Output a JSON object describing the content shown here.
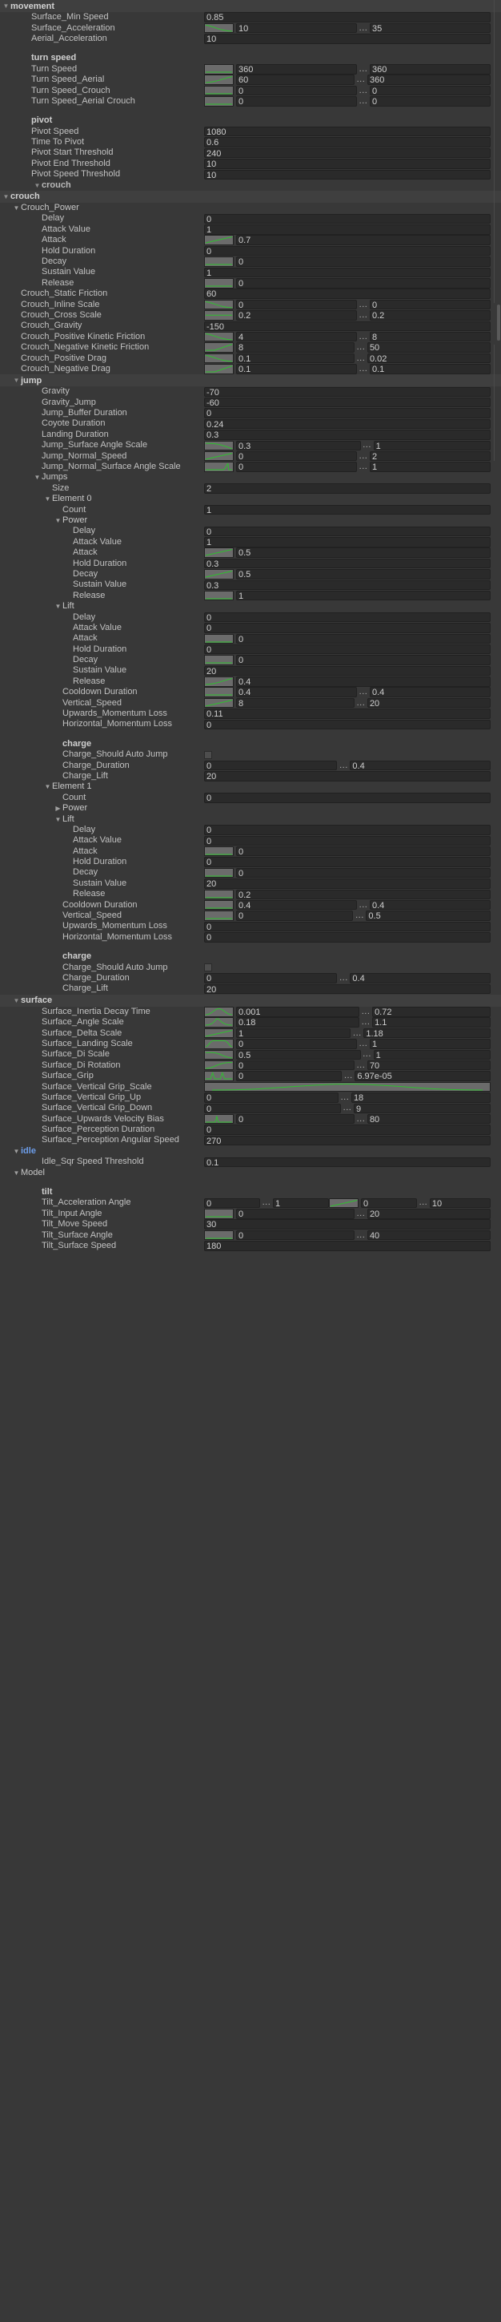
{
  "panel": {
    "title": "movement",
    "accent_color": "#6d9eeb",
    "curve_color": "#2fbf2f"
  },
  "icons": {
    "foldout_open": "▼",
    "foldout_closed": "▶",
    "range_dots": "...",
    "curve": "curve-swatch",
    "checkbox": "checkbox"
  },
  "sections": [
    {
      "kind": "header",
      "label": "movement",
      "indent": 0,
      "open": true,
      "accent": false,
      "name": "section-movement"
    },
    {
      "kind": "field",
      "label": "Surface_Min Speed",
      "indent": 2,
      "value": "0.85"
    },
    {
      "kind": "field",
      "label": "Surface_Acceleration",
      "indent": 2,
      "curve": "down",
      "value": "10",
      "dots": "...",
      "value2": "35"
    },
    {
      "kind": "field",
      "label": "Aerial_Acceleration",
      "indent": 2,
      "value": "10"
    },
    {
      "kind": "spacer"
    },
    {
      "kind": "group",
      "label": "turn speed",
      "indent": 2
    },
    {
      "kind": "field",
      "label": "Turn Speed",
      "indent": 2,
      "curve": "flat",
      "value": "360",
      "dots": "...",
      "value2": "360"
    },
    {
      "kind": "field",
      "label": "Turn Speed_Aerial",
      "indent": 2,
      "curve": "easein",
      "value": "60",
      "dots": "...",
      "value2": "360"
    },
    {
      "kind": "field",
      "label": "Turn Speed_Crouch",
      "indent": 2,
      "curve": "flat",
      "value": "0",
      "dots": "...",
      "value2": "0"
    },
    {
      "kind": "field",
      "label": "Turn Speed_Aerial Crouch",
      "indent": 2,
      "curve": "flat",
      "value": "0",
      "dots": "...",
      "value2": "0"
    },
    {
      "kind": "spacer"
    },
    {
      "kind": "group",
      "label": "pivot",
      "indent": 2
    },
    {
      "kind": "field",
      "label": "Pivot Speed",
      "indent": 2,
      "value": "1080"
    },
    {
      "kind": "field",
      "label": "Time To Pivot",
      "indent": 2,
      "value": "0.6"
    },
    {
      "kind": "field",
      "label": "Pivot Start Threshold",
      "indent": 2,
      "value": "240"
    },
    {
      "kind": "field",
      "label": "Pivot End Threshold",
      "indent": 2,
      "value": "10"
    },
    {
      "kind": "field",
      "label": "Pivot Speed Threshold",
      "indent": 2,
      "value": "10"
    },
    {
      "kind": "foldout",
      "label": "crouch",
      "indent": 3,
      "open": true,
      "bold": true,
      "dim": true
    },
    {
      "kind": "header",
      "label": "crouch",
      "indent": 0,
      "open": true,
      "accent": false,
      "name": "section-crouch"
    },
    {
      "kind": "foldout",
      "label": "Crouch_Power",
      "indent": 1,
      "open": true
    },
    {
      "kind": "field",
      "label": "Delay",
      "indent": 3,
      "value": "0"
    },
    {
      "kind": "field",
      "label": "Attack Value",
      "indent": 3,
      "value": "1"
    },
    {
      "kind": "field",
      "label": "Attack",
      "indent": 3,
      "curve": "linear",
      "value": "0.7"
    },
    {
      "kind": "field",
      "label": "Hold Duration",
      "indent": 3,
      "value": "0"
    },
    {
      "kind": "field",
      "label": "Decay",
      "indent": 3,
      "curve": "flat",
      "value": "0"
    },
    {
      "kind": "field",
      "label": "Sustain Value",
      "indent": 3,
      "value": "1"
    },
    {
      "kind": "field",
      "label": "Release",
      "indent": 3,
      "curve": "flat",
      "value": "0"
    },
    {
      "kind": "field",
      "label": "Crouch_Static Friction",
      "indent": 1,
      "value": "60"
    },
    {
      "kind": "field",
      "label": "Crouch_Inline Scale",
      "indent": 1,
      "curve": "down",
      "value": "0",
      "dots": "...",
      "value2": "0"
    },
    {
      "kind": "field",
      "label": "Crouch_Cross Scale",
      "indent": 1,
      "curve": "mid",
      "value": "0.2",
      "dots": "...",
      "value2": "0.2"
    },
    {
      "kind": "field",
      "label": "Crouch_Gravity",
      "indent": 1,
      "value": "-150"
    },
    {
      "kind": "field",
      "label": "Crouch_Positive Kinetic Friction",
      "indent": 1,
      "curve": "down",
      "value": "4",
      "dots": "...",
      "value2": "8",
      "clip": true
    },
    {
      "kind": "field",
      "label": "Crouch_Negative Kinetic Friction",
      "indent": 1,
      "curve": "rampup",
      "value": "8",
      "dots": "...",
      "value2": "50",
      "clip": true
    },
    {
      "kind": "field",
      "label": "Crouch_Positive Drag",
      "indent": 1,
      "curve": "down",
      "value": "0.1",
      "dots": "...",
      "value2": "0.02"
    },
    {
      "kind": "field",
      "label": "Crouch_Negative Drag",
      "indent": 1,
      "curve": "rampup",
      "value": "0.1",
      "dots": "...",
      "value2": "0.1"
    },
    {
      "kind": "header",
      "label": "jump",
      "indent": 1,
      "open": true,
      "accent": false,
      "name": "section-jump"
    },
    {
      "kind": "field",
      "label": "Gravity",
      "indent": 3,
      "value": "-70"
    },
    {
      "kind": "field",
      "label": "Gravity_Jump",
      "indent": 3,
      "value": "-60"
    },
    {
      "kind": "field",
      "label": "Jump_Buffer Duration",
      "indent": 3,
      "value": "0"
    },
    {
      "kind": "field",
      "label": "Coyote Duration",
      "indent": 3,
      "value": "0.24"
    },
    {
      "kind": "field",
      "label": "Landing Duration",
      "indent": 3,
      "value": "0.3"
    },
    {
      "kind": "field",
      "label": "Jump_Surface Angle Scale",
      "indent": 3,
      "curve": "easeout",
      "value": "0.3",
      "dots": "...",
      "value2": "1"
    },
    {
      "kind": "field",
      "label": "Jump_Normal_Speed",
      "indent": 3,
      "curve": "linear",
      "value": "0",
      "dots": "...",
      "value2": "2"
    },
    {
      "kind": "field",
      "label": "Jump_Normal_Surface Angle Scale",
      "indent": 3,
      "curve": "spike",
      "value": "0",
      "dots": "...",
      "value2": "1",
      "clip": true
    },
    {
      "kind": "foldout",
      "label": "Jumps",
      "indent": 3,
      "open": true
    },
    {
      "kind": "field",
      "label": "Size",
      "indent": 4,
      "value": "2"
    },
    {
      "kind": "foldout",
      "label": "Element 0",
      "indent": 4,
      "open": true
    },
    {
      "kind": "field",
      "label": "Count",
      "indent": 5,
      "value": "1"
    },
    {
      "kind": "foldout",
      "label": "Power",
      "indent": 5,
      "open": true
    },
    {
      "kind": "field",
      "label": "Delay",
      "indent": 6,
      "value": "0"
    },
    {
      "kind": "field",
      "label": "Attack Value",
      "indent": 6,
      "value": "1"
    },
    {
      "kind": "field",
      "label": "Attack",
      "indent": 6,
      "curve": "linear",
      "value": "0.5"
    },
    {
      "kind": "field",
      "label": "Hold Duration",
      "indent": 6,
      "value": "0.3"
    },
    {
      "kind": "field",
      "label": "Decay",
      "indent": 6,
      "curve": "linear",
      "value": "0.5"
    },
    {
      "kind": "field",
      "label": "Sustain Value",
      "indent": 6,
      "value": "0.3"
    },
    {
      "kind": "field",
      "label": "Release",
      "indent": 6,
      "curve": "flat",
      "value": "1"
    },
    {
      "kind": "foldout",
      "label": "Lift",
      "indent": 5,
      "open": true
    },
    {
      "kind": "field",
      "label": "Delay",
      "indent": 6,
      "value": "0"
    },
    {
      "kind": "field",
      "label": "Attack Value",
      "indent": 6,
      "value": "0"
    },
    {
      "kind": "field",
      "label": "Attack",
      "indent": 6,
      "curve": "flat",
      "value": "0"
    },
    {
      "kind": "field",
      "label": "Hold Duration",
      "indent": 6,
      "value": "0"
    },
    {
      "kind": "field",
      "label": "Decay",
      "indent": 6,
      "curve": "flat",
      "value": "0"
    },
    {
      "kind": "field",
      "label": "Sustain Value",
      "indent": 6,
      "value": "20"
    },
    {
      "kind": "field",
      "label": "Release",
      "indent": 6,
      "curve": "easein",
      "value": "0.4"
    },
    {
      "kind": "field",
      "label": "Cooldown Duration",
      "indent": 5,
      "curve": "flat",
      "value": "0.4",
      "dots": "...",
      "value2": "0.4"
    },
    {
      "kind": "field",
      "label": "Vertical_Speed",
      "indent": 5,
      "curve": "linear",
      "value": "8",
      "dots": "...",
      "value2": "20"
    },
    {
      "kind": "field",
      "label": "Upwards_Momentum Loss",
      "indent": 5,
      "value": "0.11",
      "clip": true
    },
    {
      "kind": "field",
      "label": "Horizontal_Momentum Loss",
      "indent": 5,
      "value": "0",
      "clip": true
    },
    {
      "kind": "spacer"
    },
    {
      "kind": "group",
      "label": "charge",
      "indent": 5
    },
    {
      "kind": "field",
      "label": "Charge_Should Auto Jump",
      "indent": 5,
      "checkbox": true,
      "clip": true
    },
    {
      "kind": "field",
      "label": "Charge_Duration",
      "indent": 5,
      "value": "0",
      "dots": "...",
      "value2": "0.4"
    },
    {
      "kind": "field",
      "label": "Charge_Lift",
      "indent": 5,
      "value": "20"
    },
    {
      "kind": "foldout",
      "label": "Element 1",
      "indent": 4,
      "open": true
    },
    {
      "kind": "field",
      "label": "Count",
      "indent": 5,
      "value": "0"
    },
    {
      "kind": "foldout",
      "label": "Power",
      "indent": 5,
      "open": false
    },
    {
      "kind": "foldout",
      "label": "Lift",
      "indent": 5,
      "open": true
    },
    {
      "kind": "field",
      "label": "Delay",
      "indent": 6,
      "value": "0"
    },
    {
      "kind": "field",
      "label": "Attack Value",
      "indent": 6,
      "value": "0"
    },
    {
      "kind": "field",
      "label": "Attack",
      "indent": 6,
      "curve": "flat",
      "value": "0"
    },
    {
      "kind": "field",
      "label": "Hold Duration",
      "indent": 6,
      "value": "0"
    },
    {
      "kind": "field",
      "label": "Decay",
      "indent": 6,
      "curve": "flat",
      "value": "0"
    },
    {
      "kind": "field",
      "label": "Sustain Value",
      "indent": 6,
      "value": "20"
    },
    {
      "kind": "field",
      "label": "Release",
      "indent": 6,
      "curve": "flat",
      "value": "0.2"
    },
    {
      "kind": "field",
      "label": "Cooldown Duration",
      "indent": 5,
      "curve": "flat",
      "value": "0.4",
      "dots": "...",
      "value2": "0.4"
    },
    {
      "kind": "field",
      "label": "Vertical_Speed",
      "indent": 5,
      "curve": "flat",
      "value": "0",
      "dots": "...",
      "value2": "0.5"
    },
    {
      "kind": "field",
      "label": "Upwards_Momentum Loss",
      "indent": 5,
      "value": "0",
      "clip": true
    },
    {
      "kind": "field",
      "label": "Horizontal_Momentum Loss",
      "indent": 5,
      "value": "0",
      "clip": true
    },
    {
      "kind": "spacer"
    },
    {
      "kind": "group",
      "label": "charge",
      "indent": 5
    },
    {
      "kind": "field",
      "label": "Charge_Should Auto Jump",
      "indent": 5,
      "checkbox": true,
      "clip": true
    },
    {
      "kind": "field",
      "label": "Charge_Duration",
      "indent": 5,
      "value": "0",
      "dots": "...",
      "value2": "0.4"
    },
    {
      "kind": "field",
      "label": "Charge_Lift",
      "indent": 5,
      "value": "20"
    },
    {
      "kind": "header",
      "label": "surface",
      "indent": 1,
      "open": true,
      "accent": false,
      "name": "section-surface"
    },
    {
      "kind": "field",
      "label": "Surface_Inertia Decay Time",
      "indent": 3,
      "curve": "bell",
      "value": "0.001",
      "dots": "...",
      "value2": "0.72"
    },
    {
      "kind": "field",
      "label": "Surface_Angle Scale",
      "indent": 3,
      "curve": "narrowbell",
      "value": "0.18",
      "dots": "...",
      "value2": "1.1"
    },
    {
      "kind": "field",
      "label": "Surface_Delta Scale",
      "indent": 3,
      "curve": "linear",
      "value": "1",
      "dots": "...",
      "value2": "1.18"
    },
    {
      "kind": "field",
      "label": "Surface_Landing Scale",
      "indent": 3,
      "curve": "plateau",
      "value": "0",
      "dots": "...",
      "value2": "1"
    },
    {
      "kind": "field",
      "label": "Surface_Di Scale",
      "indent": 3,
      "curve": "falloff",
      "value": "0.5",
      "dots": "...",
      "value2": "1"
    },
    {
      "kind": "field",
      "label": "Surface_Di Rotation",
      "indent": 3,
      "curve": "sigmoid",
      "value": "0",
      "dots": "...",
      "value2": "70"
    },
    {
      "kind": "field",
      "label": "Surface_Grip",
      "indent": 3,
      "curve": "twopeaks",
      "value": "0",
      "dots": "...",
      "value2": "6.97e-05"
    },
    {
      "kind": "field",
      "label": "Surface_Vertical Grip_Scale",
      "indent": 3,
      "curvewide": "bigbell",
      "clip": true
    },
    {
      "kind": "field",
      "label": "Surface_Vertical Grip_Up",
      "indent": 3,
      "value": "0",
      "dots": "...",
      "value2": "18"
    },
    {
      "kind": "field",
      "label": "Surface_Vertical Grip_Down",
      "indent": 3,
      "value": "0",
      "dots": "...",
      "value2": "9"
    },
    {
      "kind": "field",
      "label": "Surface_Upwards Velocity Bias",
      "indent": 3,
      "curve": "peak",
      "value": "0",
      "dots": "...",
      "value2": "80",
      "clip": true
    },
    {
      "kind": "field",
      "label": "Surface_Perception Duration",
      "indent": 3,
      "value": "0",
      "clip": true
    },
    {
      "kind": "field",
      "label": "Surface_Perception Angular Speed",
      "indent": 3,
      "value": "270",
      "clip": true
    },
    {
      "kind": "foldout",
      "label": "idle",
      "indent": 1,
      "open": true,
      "bold": true,
      "accent": true,
      "name": "section-idle"
    },
    {
      "kind": "field",
      "label": "Idle_Sqr Speed Threshold",
      "indent": 3,
      "value": "0.1"
    },
    {
      "kind": "foldout",
      "label": "Model",
      "indent": 1,
      "open": true,
      "name": "section-model"
    },
    {
      "kind": "spacer"
    },
    {
      "kind": "group",
      "label": "tilt",
      "indent": 3
    },
    {
      "kind": "field",
      "label": "Tilt_Acceleration Angle",
      "indent": 3,
      "quad": true,
      "value": "0",
      "dots": "...",
      "value2": "1",
      "curve": "linear",
      "value3": "0",
      "dots2": "...",
      "value4": "10"
    },
    {
      "kind": "field",
      "label": "Tilt_Input Angle",
      "indent": 3,
      "curve": "flat",
      "value": "0",
      "dots": "...",
      "value2": "20"
    },
    {
      "kind": "field",
      "label": "Tilt_Move Speed",
      "indent": 3,
      "value": "30"
    },
    {
      "kind": "field",
      "label": "Tilt_Surface Angle",
      "indent": 3,
      "curve": "flat",
      "value": "0",
      "dots": "...",
      "value2": "40"
    },
    {
      "kind": "field",
      "label": "Tilt_Surface Speed",
      "indent": 3,
      "value": "180"
    }
  ]
}
